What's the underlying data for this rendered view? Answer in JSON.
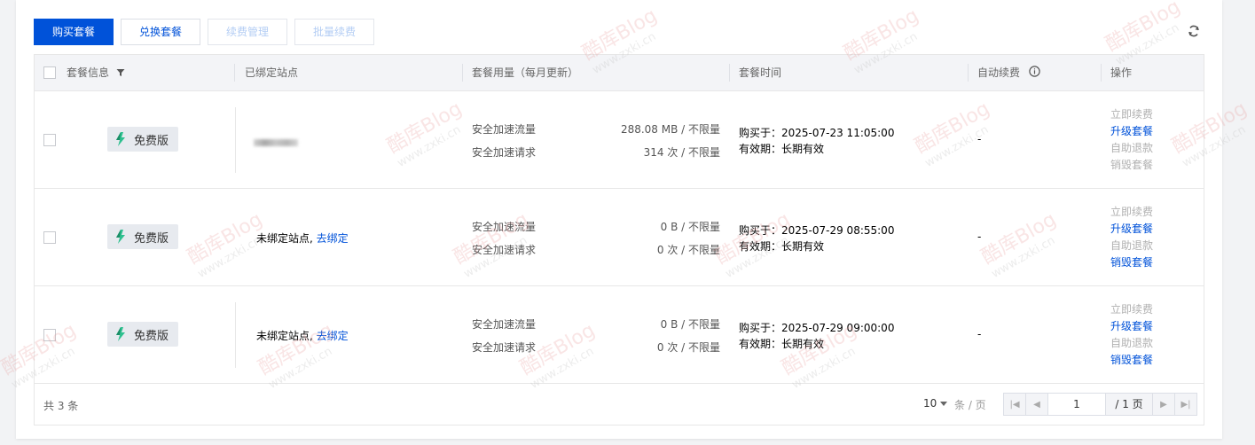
{
  "toolbar": {
    "buy_label": "购买套餐",
    "exchange_label": "兑换套餐",
    "renew_manage_label": "续费管理",
    "batch_renew_label": "批量续费"
  },
  "table": {
    "headers": {
      "package_info": "套餐信息",
      "bound_site": "已绑定站点",
      "usage": "套餐用量（每月更新）",
      "time": "套餐时间",
      "auto_renew": "自动续费",
      "actions": "操作"
    },
    "rows": [
      {
        "badge": "免费版",
        "site": "",
        "site_link": "",
        "traffic_label": "安全加速流量",
        "traffic_value": "288.08 MB / 不限量",
        "requests_label": "安全加速请求",
        "requests_value": "314 次 / 不限量",
        "purchased": "购买于：2025-07-23 11:05:00",
        "validity": "有效期：长期有效",
        "auto_renew": "-",
        "actions": [
          "立即续费",
          "升级套餐",
          "自助退款",
          "销毁套餐"
        ]
      },
      {
        "badge": "免费版",
        "site": "未绑定站点,",
        "site_link": "去绑定",
        "traffic_label": "安全加速流量",
        "traffic_value": "0 B / 不限量",
        "requests_label": "安全加速请求",
        "requests_value": "0 次 / 不限量",
        "purchased": "购买于：2025-07-29 08:55:00",
        "validity": "有效期：长期有效",
        "auto_renew": "-",
        "actions": [
          "立即续费",
          "升级套餐",
          "自助退款",
          "销毁套餐"
        ]
      },
      {
        "badge": "免费版",
        "site": "未绑定站点,",
        "site_link": "去绑定",
        "traffic_label": "安全加速流量",
        "traffic_value": "0 B / 不限量",
        "requests_label": "安全加速请求",
        "requests_value": "0 次 / 不限量",
        "purchased": "购买于：2025-07-29 09:00:00",
        "validity": "有效期：长期有效",
        "auto_renew": "-",
        "actions": [
          "立即续费",
          "升级套餐",
          "自助退款",
          "销毁套餐"
        ]
      }
    ]
  },
  "footer": {
    "total": "共 3 条",
    "page_size": "10",
    "per_page": "条 / 页",
    "current_page": "1",
    "total_pages": "/ 1 页"
  },
  "watermark": {
    "brand": "酷库Blog",
    "url": "www.zxki.cn"
  },
  "colors": {
    "primary": "#0052d9",
    "disabled_text": "#b0b0b0",
    "header_bg": "#f3f4f7"
  },
  "icons": {
    "filter": "filter-icon",
    "info": "info-circle-icon",
    "refresh": "refresh-icon",
    "badge": "lightning-leaf-icon"
  }
}
